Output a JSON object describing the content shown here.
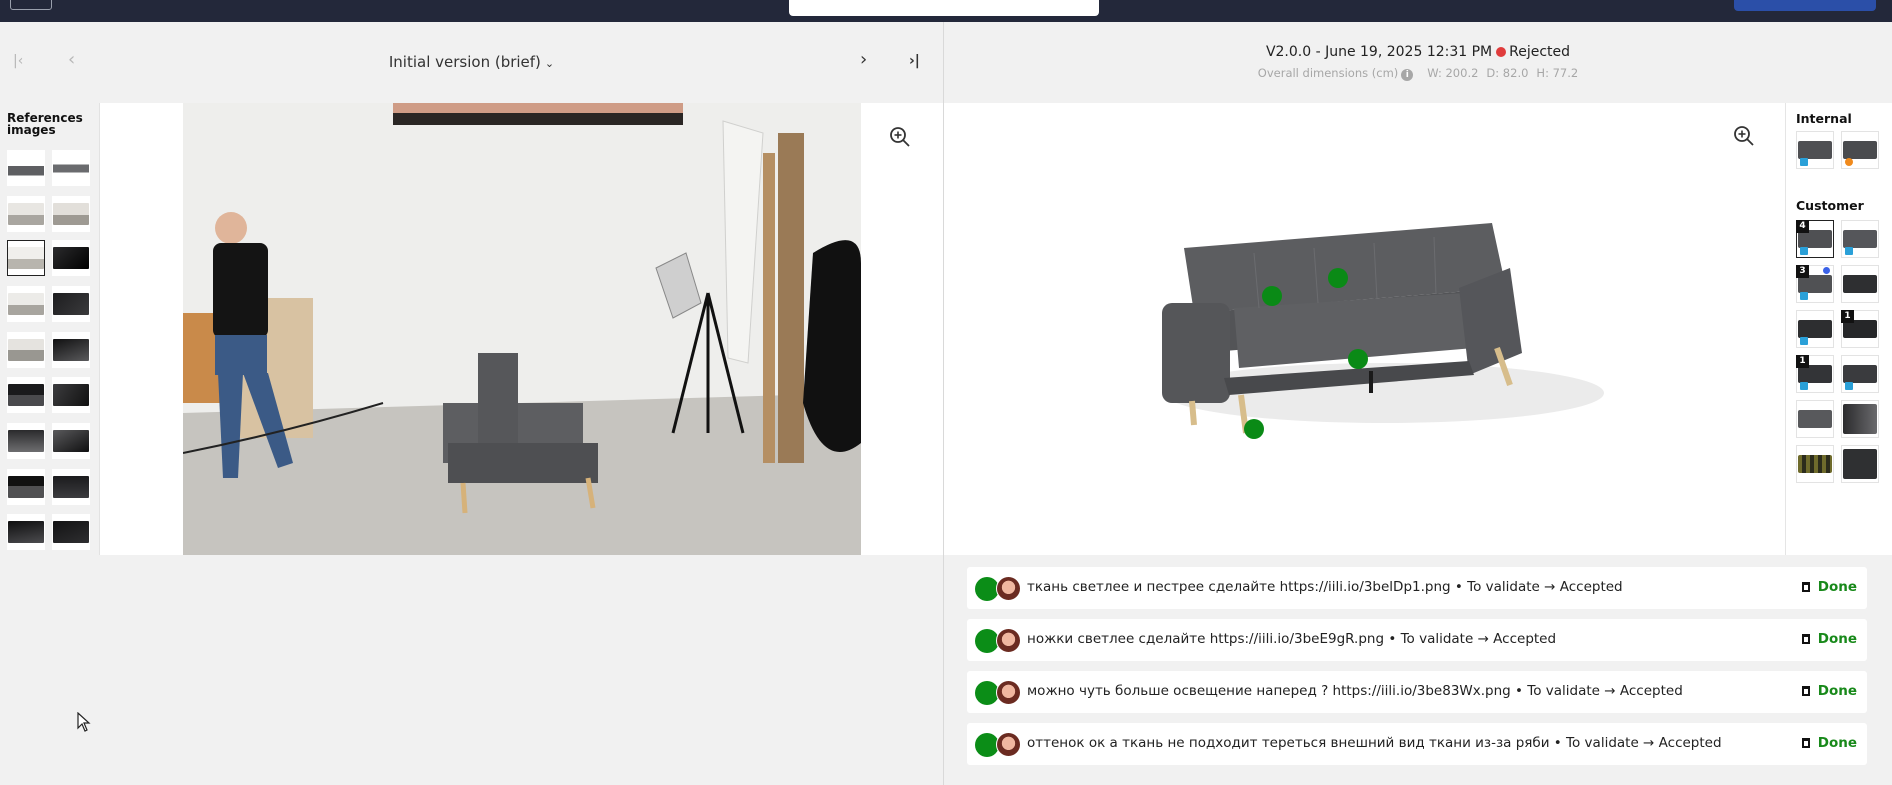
{
  "left": {
    "nav": {
      "first_glyph": "|‹",
      "prev_glyph": "‹",
      "next_glyph": "›",
      "last_glyph": "›|",
      "version_label": "Initial version (brief)"
    },
    "references_title": "References images"
  },
  "right": {
    "header": {
      "version": "V2.0.0 - June 19, 2025 12:31 PM",
      "status": "Rejected",
      "dims_label": "Overall dimensions (cm)",
      "width": "W: 200.2",
      "depth": "D: 82.0",
      "height": "H: 77.2"
    },
    "internal_title": "Internal",
    "customer_title": "Customer",
    "customer_badges": [
      "4",
      "3",
      "1",
      "1"
    ]
  },
  "comments": [
    {
      "text": "ткань светлее и пестрее сделайте https://iili.io/3belDp1.png • To validate → Accepted",
      "status": "Done"
    },
    {
      "text": "ножки светлее сделайте https://iili.io/3beE9gR.png • To validate → Accepted",
      "status": "Done"
    },
    {
      "text": "можно чуть больше освещение наперед ? https://iili.io/3be83Wx.png • To validate → Accepted",
      "status": "Done"
    },
    {
      "text": "оттенок ок а ткань не подходит тереться внешний вид ткани из-за ряби • To validate → Accepted",
      "status": "Done"
    }
  ],
  "colors": {
    "topbar": "#23283a",
    "status_rejected": "#e03c3c",
    "done_green": "#18891a",
    "marker_green": "#0a8a16",
    "sofa_grey": "#5a5b5e"
  }
}
